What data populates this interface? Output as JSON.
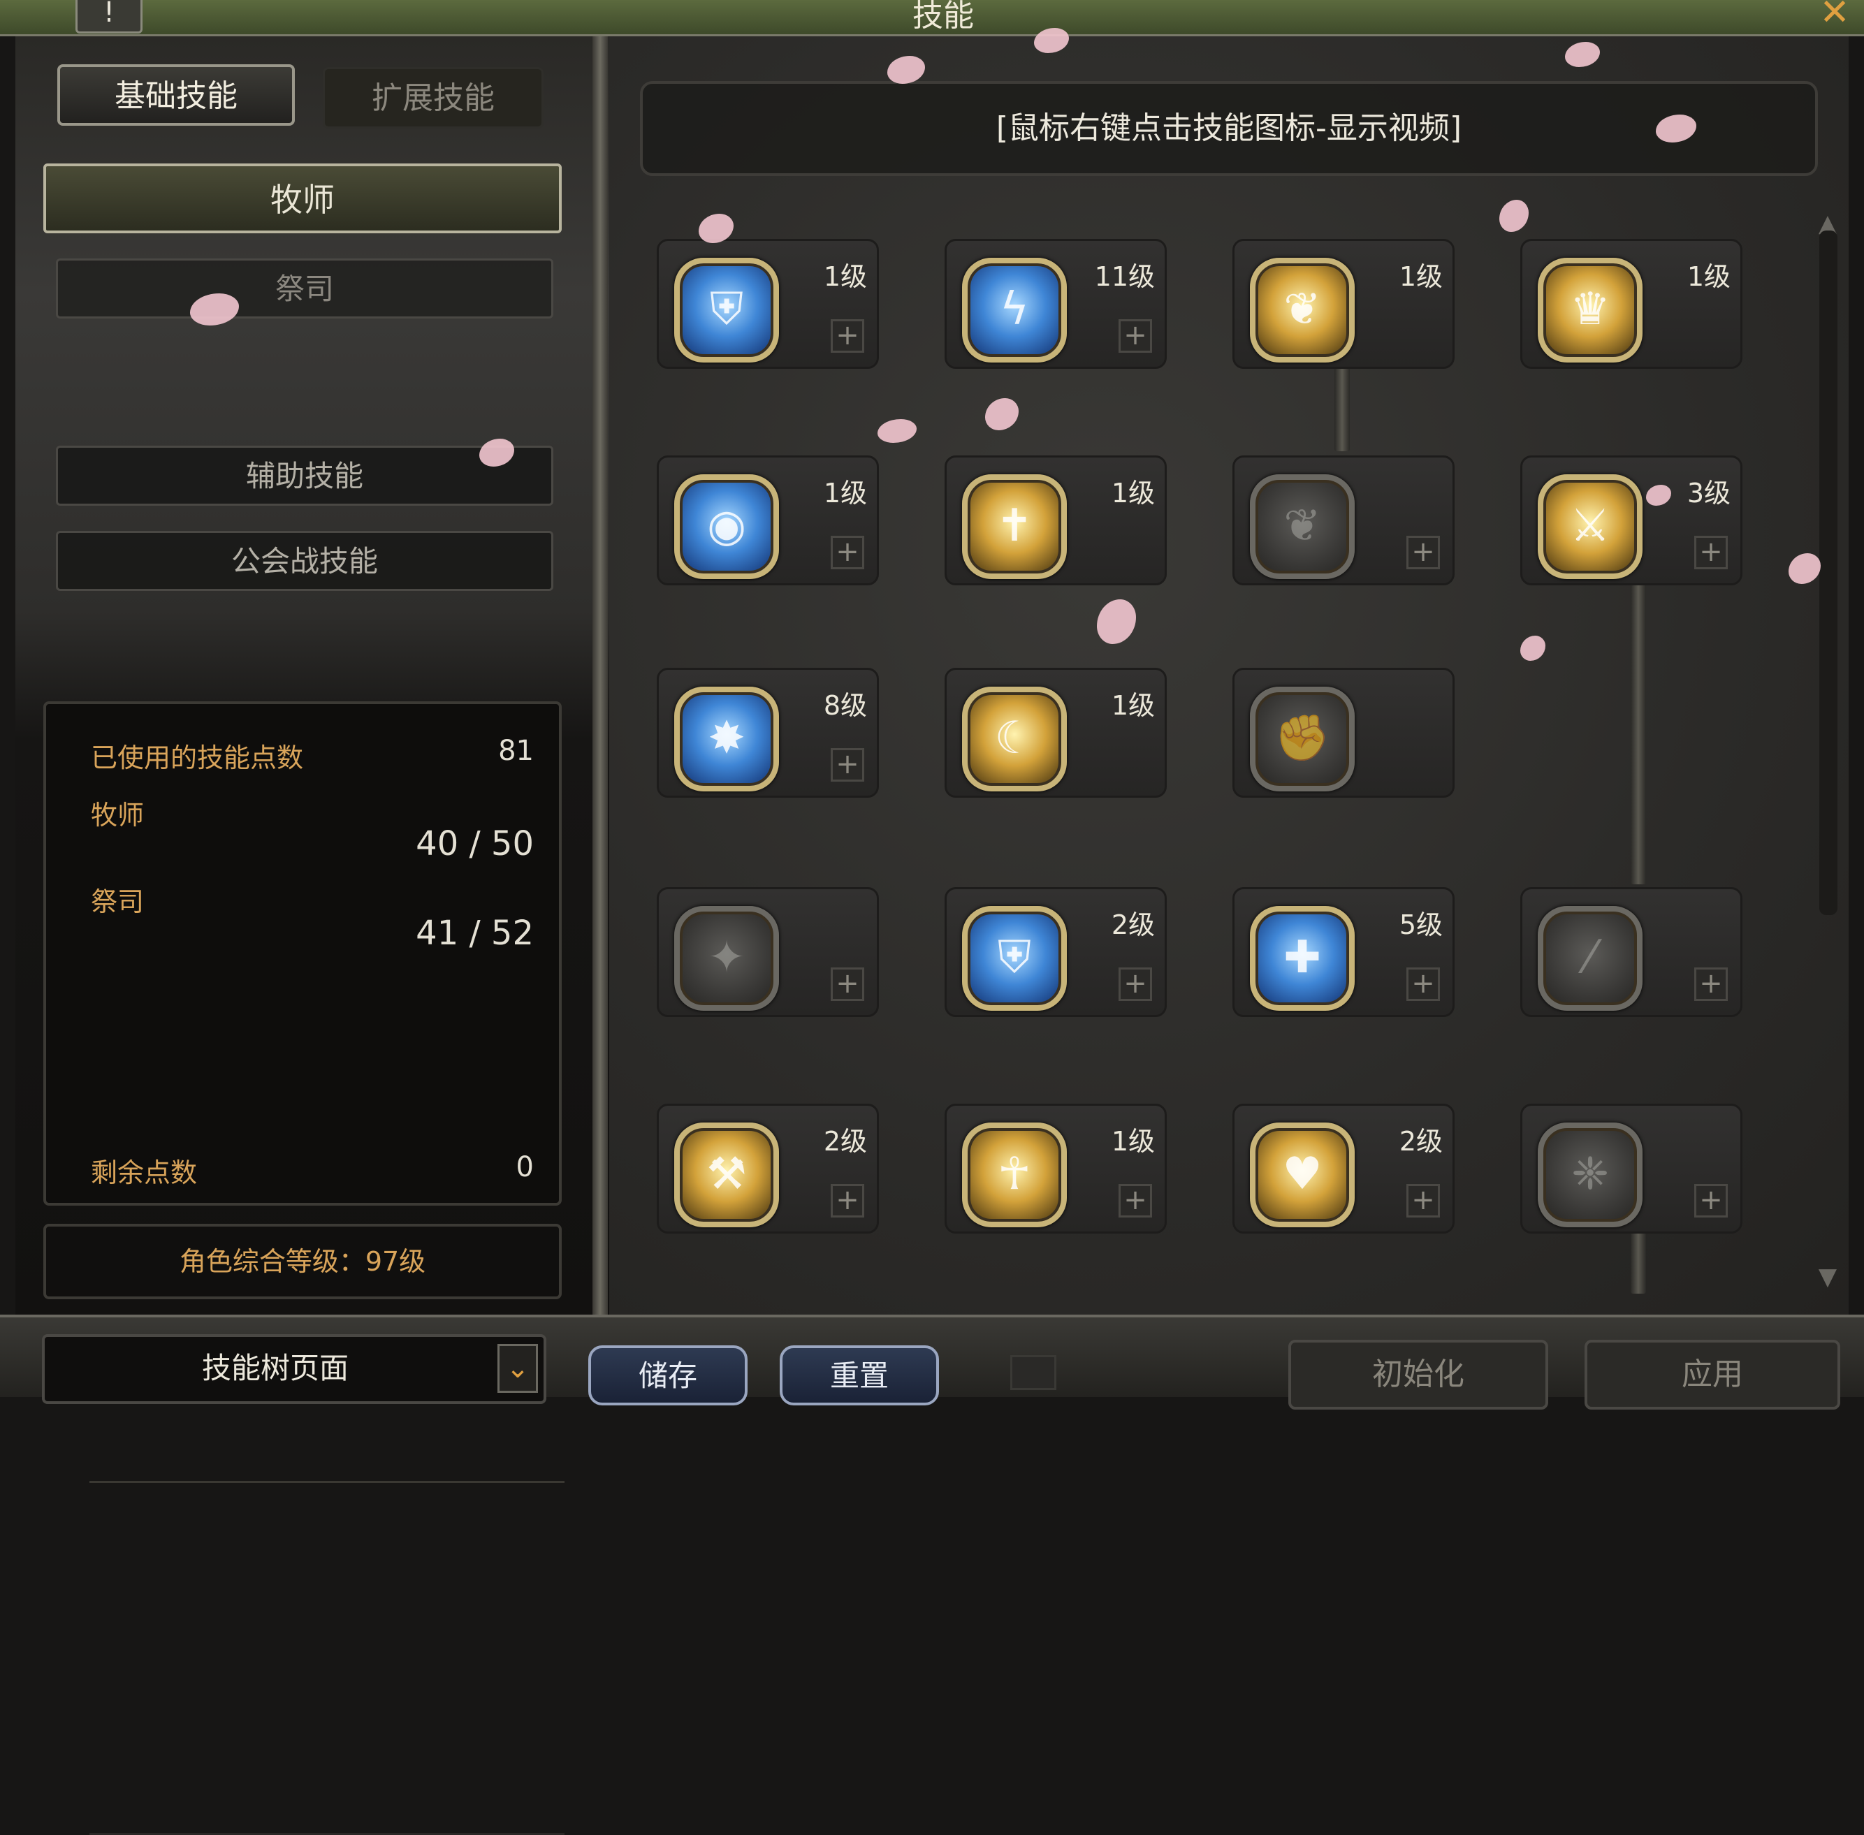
{
  "window": {
    "title": "技能",
    "help_label": "!",
    "close_label": "✕"
  },
  "left": {
    "tabs": [
      {
        "label": "基础技能"
      },
      {
        "label": "扩展技能"
      }
    ],
    "categories": [
      {
        "label": "牧师"
      },
      {
        "label": "祭司"
      },
      {
        "label": "辅助技能"
      },
      {
        "label": "公会战技能"
      }
    ],
    "points": {
      "used_label": "已使用的技能点数",
      "used_value": "81",
      "class1_label": "牧师",
      "class1_value": "40 / 50",
      "class2_label": "祭司",
      "class2_value": "41 / 52",
      "remaining_label": "剩余点数",
      "remaining_value": "0"
    },
    "overall_level": "角色综合等级：97级"
  },
  "right": {
    "hint": "[鼠标右键点击技能图标-显示视频]",
    "skills": [
      {
        "level": "1级",
        "style": "blue",
        "glyph": "shield-icon",
        "plus": "+"
      },
      {
        "level": "11级",
        "style": "blue",
        "glyph": "lightning-icon",
        "plus": "+"
      },
      {
        "level": "1级",
        "style": "gold",
        "glyph": "bird-icon",
        "plus": ""
      },
      {
        "level": "1级",
        "style": "gold",
        "glyph": "summon-icon",
        "plus": ""
      },
      {
        "level": "1级",
        "style": "blue",
        "glyph": "circle-icon",
        "plus": "+"
      },
      {
        "level": "1级",
        "style": "gold",
        "glyph": "priest-icon",
        "plus": ""
      },
      {
        "level": "",
        "style": "dark",
        "glyph": "bird-icon",
        "plus": "+"
      },
      {
        "level": "3级",
        "style": "gold",
        "glyph": "sword-icon",
        "plus": "+"
      },
      {
        "level": "8级",
        "style": "blue",
        "glyph": "burst-icon",
        "plus": "+"
      },
      {
        "level": "1级",
        "style": "gold",
        "glyph": "arc-icon",
        "plus": ""
      },
      {
        "level": "",
        "style": "dark",
        "glyph": "fist-icon",
        "plus": ""
      },
      {
        "level": "",
        "style": "dark",
        "glyph": "star-icon",
        "plus": "+"
      },
      {
        "level": "2级",
        "style": "blue",
        "glyph": "shield-icon",
        "plus": "+"
      },
      {
        "level": "5级",
        "style": "blue",
        "glyph": "cross-icon",
        "plus": "+"
      },
      {
        "level": "",
        "style": "dark",
        "glyph": "slash-icon",
        "plus": "+"
      },
      {
        "level": "2级",
        "style": "gold",
        "glyph": "hammer-icon",
        "plus": "+"
      },
      {
        "level": "1级",
        "style": "gold",
        "glyph": "figure-icon",
        "plus": "+"
      },
      {
        "level": "2级",
        "style": "gold",
        "glyph": "hp-icon",
        "plus": "+"
      },
      {
        "level": "",
        "style": "dark",
        "glyph": "claw-icon",
        "plus": "+"
      }
    ]
  },
  "bottom": {
    "tree_select": "技能树页面",
    "save_label": "储存",
    "reset_label": "重置",
    "init_label": "初始化",
    "apply_label": "应用"
  }
}
